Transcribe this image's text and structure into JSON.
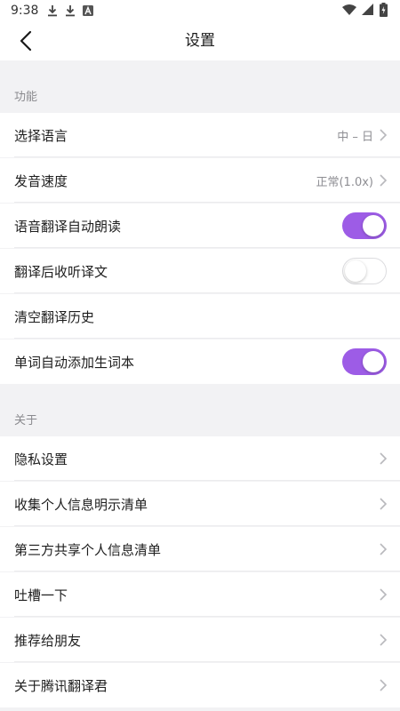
{
  "status_bar": {
    "time": "9:38",
    "icons": [
      "download-icon",
      "download-icon",
      "font-icon",
      "wifi-icon",
      "signal-icon",
      "battery-icon"
    ]
  },
  "header": {
    "title": "设置",
    "back_icon": "back-arrow-icon"
  },
  "sections": {
    "function": {
      "title": "功能",
      "items": [
        {
          "label": "选择语言",
          "value": "中 – 日",
          "control": "chevron"
        },
        {
          "label": "发音速度",
          "value": "正常(1.0x)",
          "control": "chevron"
        },
        {
          "label": "语音翻译自动朗读",
          "control": "toggle",
          "on": true
        },
        {
          "label": "翻译后收听译文",
          "control": "toggle",
          "on": false
        },
        {
          "label": "清空翻译历史",
          "control": "none"
        },
        {
          "label": "单词自动添加生词本",
          "control": "toggle",
          "on": true
        }
      ]
    },
    "about": {
      "title": "关于",
      "items": [
        {
          "label": "隐私设置",
          "control": "chevron"
        },
        {
          "label": "收集个人信息明示清单",
          "control": "chevron"
        },
        {
          "label": "第三方共享个人信息清单",
          "control": "chevron"
        },
        {
          "label": "吐槽一下",
          "control": "chevron"
        },
        {
          "label": "推荐给朋友",
          "control": "chevron"
        },
        {
          "label": "关于腾讯翻译君",
          "control": "chevron"
        }
      ]
    }
  },
  "colors": {
    "accent": "#9d5ce6",
    "background": "#f2f2f4",
    "row_background": "#ffffff",
    "section_title": "#8a8a8e"
  }
}
